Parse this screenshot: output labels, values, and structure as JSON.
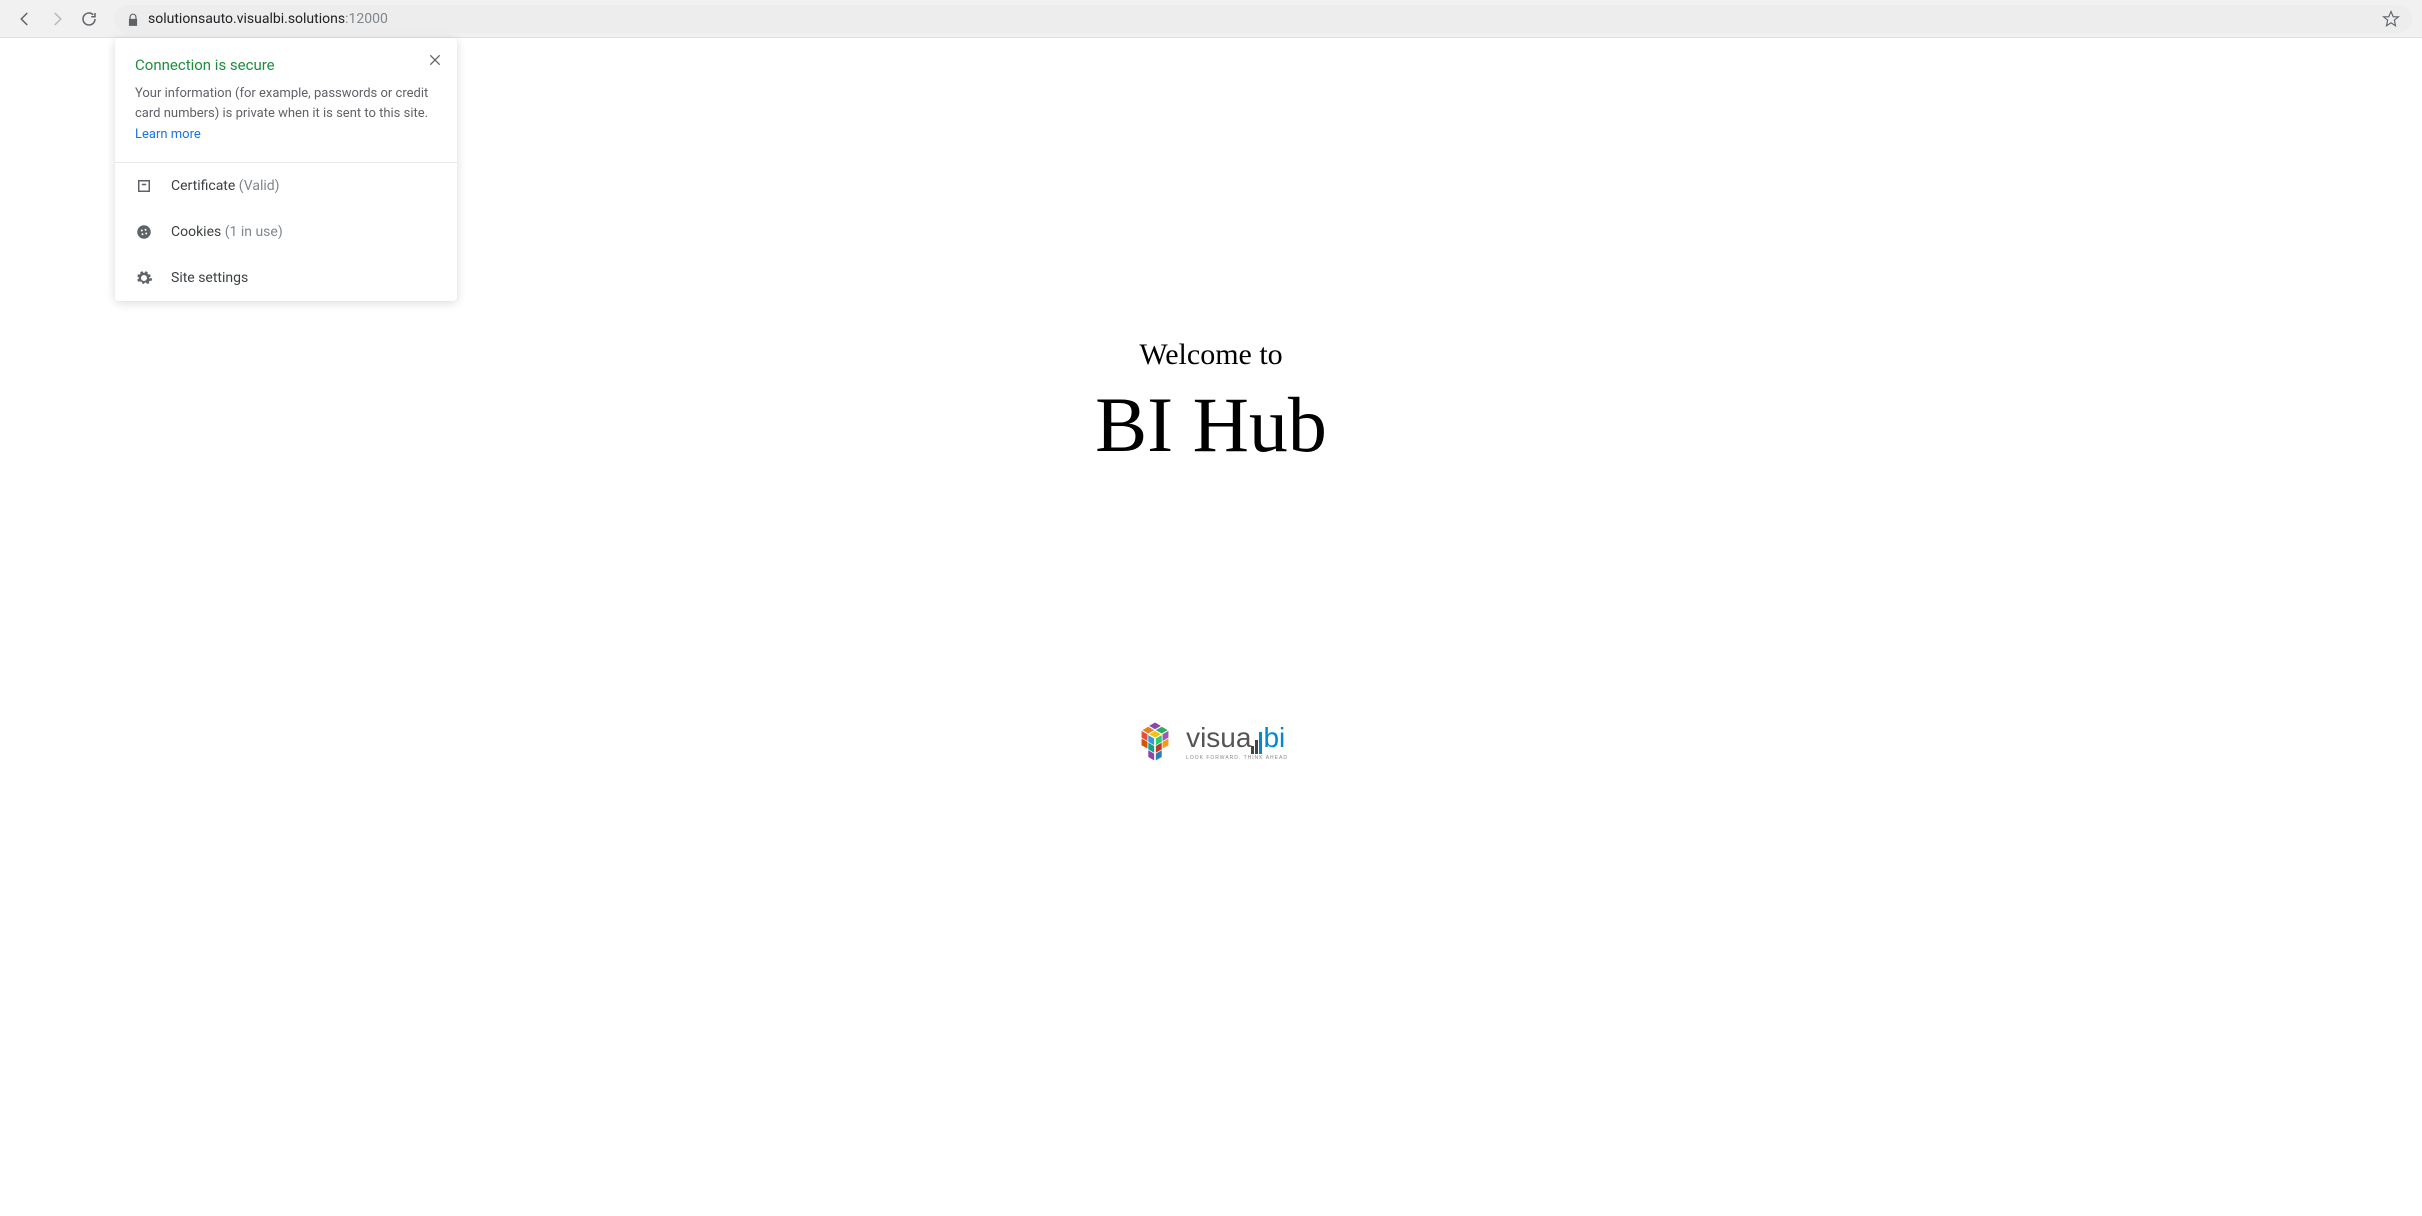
{
  "browser": {
    "url_host": "solutionsauto.visualbi.solutions",
    "url_port": ":12000"
  },
  "site_popup": {
    "title": "Connection is secure",
    "description": "Your information (for example, passwords or credit card numbers) is private when it is sent to this site.",
    "learn_more": "Learn more",
    "items": {
      "certificate_label": "Certificate",
      "certificate_hint": "(Valid)",
      "cookies_label": "Cookies",
      "cookies_hint": "(1 in use)",
      "site_settings_label": "Site settings"
    }
  },
  "page": {
    "welcome": "Welcome to",
    "product": "BI Hub",
    "logo_text_pre": "visua",
    "logo_text_bi": "bi",
    "logo_tagline": "LOOK FORWARD. THINK AHEAD"
  }
}
